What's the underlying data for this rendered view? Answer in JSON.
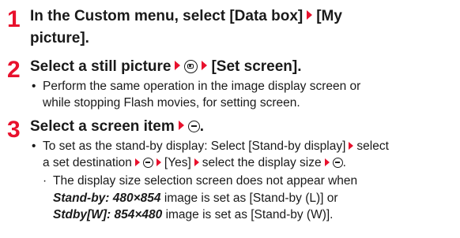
{
  "steps": [
    {
      "number": "1",
      "line1_a": "In the Custom menu, select [Data box]",
      "line1_b": "[My",
      "line2": "picture]."
    },
    {
      "number": "2",
      "part_a": "Select a still picture",
      "part_b": "[Set screen].",
      "bullet_line1": "Perform the same operation in the image display screen or",
      "bullet_line2": "while stopping Flash movies, for setting screen."
    },
    {
      "number": "3",
      "part_a": "Select a screen item",
      "bullet": {
        "l1_a": "To set as the stand-by display: Select [Stand-by display]",
        "l1_b": "select",
        "l2_a": "a set destination",
        "l2_b": "[Yes]",
        "l2_c": "select the display size"
      },
      "sub": {
        "l1": "The display size selection screen does not appear when",
        "l2_bold": "Stand-by: 480×854",
        "l2_rest": " image is set as [Stand-by (L)] or",
        "l3_bold": "Stdby[W]: 854×480",
        "l3_rest": " image is set as [Stand-by (W)]."
      }
    }
  ],
  "glyphs": {
    "bullet_mark": "•",
    "sub_mark": "·"
  },
  "icons": {
    "arrow": "arrow-right-icon",
    "center_key": "center-key-icon",
    "camera_key": "camera-key-icon"
  },
  "colors": {
    "accent": "#e8112d",
    "text": "#1a1a1a"
  }
}
